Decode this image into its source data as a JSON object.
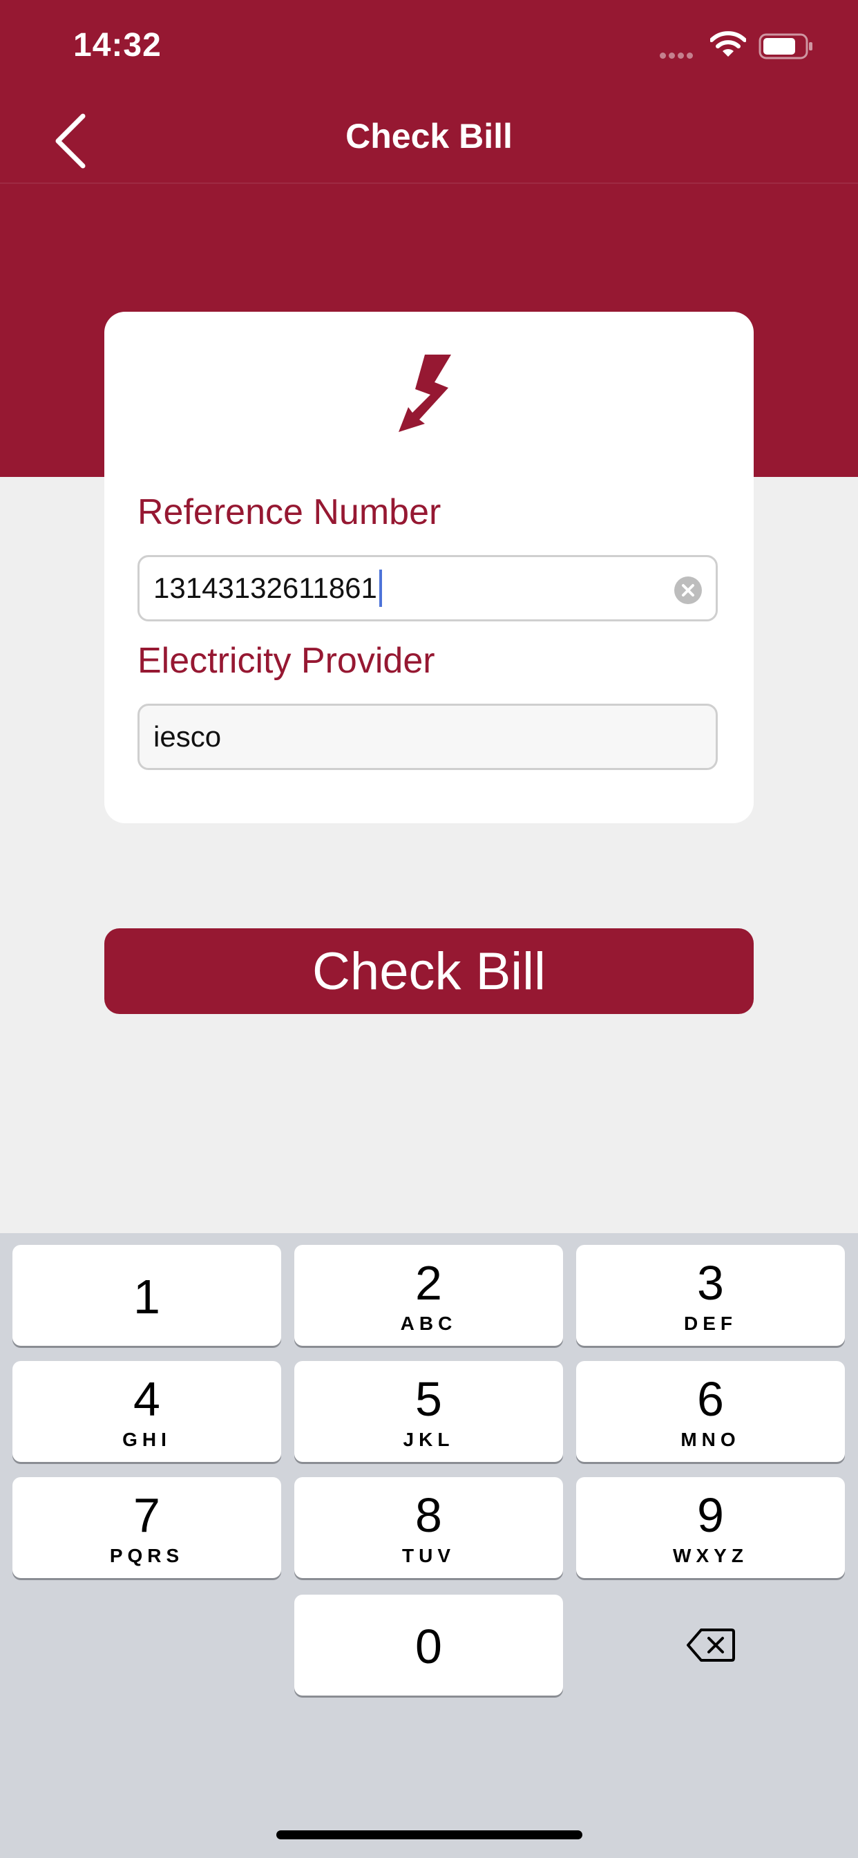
{
  "status": {
    "time": "14:32"
  },
  "nav": {
    "title": "Check Bill"
  },
  "form": {
    "reference_label": "Reference Number",
    "reference_value": "13143132611861",
    "provider_label": "Electricity Provider",
    "provider_value": "iesco"
  },
  "actions": {
    "check_bill_label": "Check Bill"
  },
  "keyboard": {
    "keys": [
      {
        "num": "1",
        "letters": ""
      },
      {
        "num": "2",
        "letters": "ABC"
      },
      {
        "num": "3",
        "letters": "DEF"
      },
      {
        "num": "4",
        "letters": "GHI"
      },
      {
        "num": "5",
        "letters": "JKL"
      },
      {
        "num": "6",
        "letters": "MNO"
      },
      {
        "num": "7",
        "letters": "PQRS"
      },
      {
        "num": "8",
        "letters": "TUV"
      },
      {
        "num": "9",
        "letters": "WXYZ"
      },
      {
        "num": "0",
        "letters": ""
      }
    ]
  },
  "colors": {
    "brand": "#961832",
    "background": "#efefef",
    "keyboard": "#d1d4da"
  }
}
